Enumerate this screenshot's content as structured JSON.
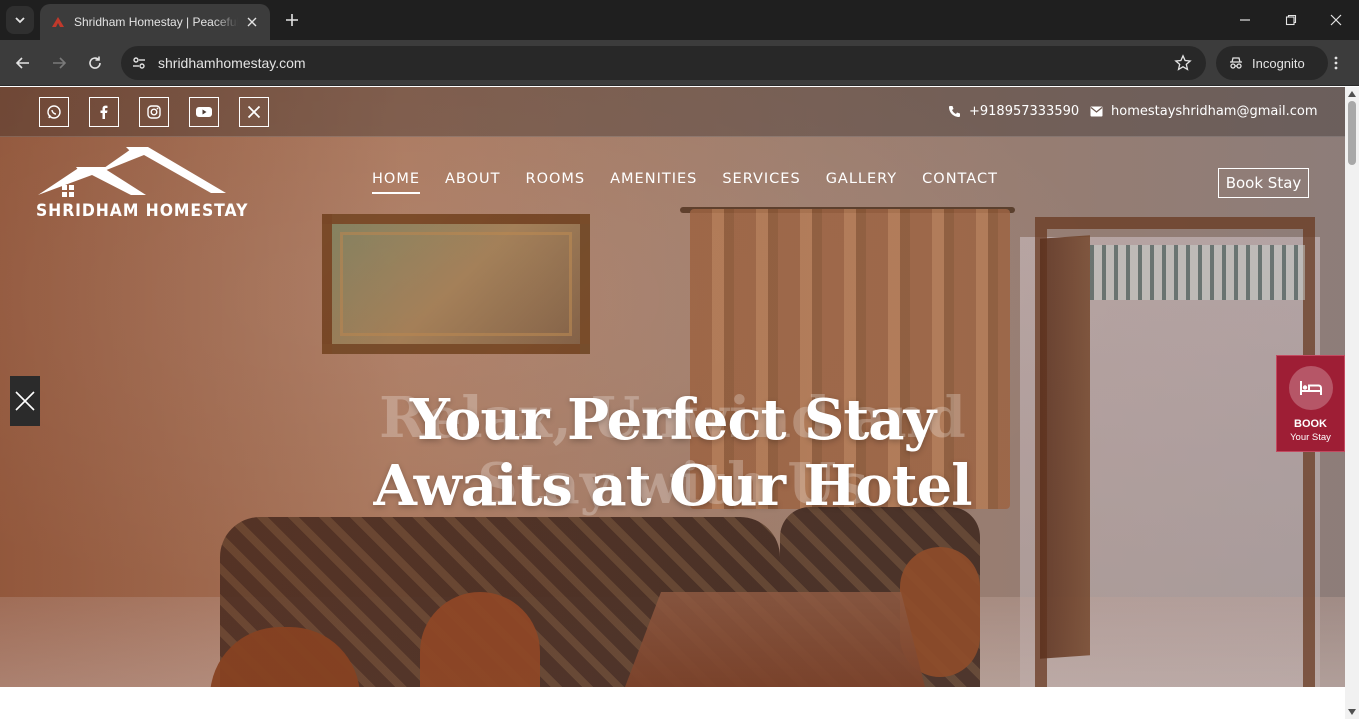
{
  "browser": {
    "tab_title": "Shridham Homestay | Peaceful & Comfortable Stay",
    "url": "shridhamhomestay.com",
    "incognito_label": "Incognito"
  },
  "topbar": {
    "social": [
      "whatsapp-icon",
      "facebook-icon",
      "instagram-icon",
      "youtube-icon",
      "x-icon"
    ],
    "phone": "+918957333590",
    "email": "homestayshridham@gmail.com"
  },
  "header": {
    "logo_text": "SHRIDHAM HOMESTAY",
    "nav": [
      "HOME",
      "ABOUT",
      "ROOMS",
      "AMENITIES",
      "SERVICES",
      "GALLERY",
      "CONTACT"
    ],
    "active_nav": "HOME",
    "book_button": "Book Stay"
  },
  "hero": {
    "headline_line1": "Your Perfect Stay",
    "headline_line2": "Awaits at Our Hotel",
    "ghost_line1": "Relax, Unwind and",
    "ghost_line2": "Stay with Us"
  },
  "floating_book": {
    "line1": "BOOK",
    "line2": "Your Stay"
  },
  "colors": {
    "accent": "#9e1e35",
    "chrome_dark": "#1f1f1f",
    "chrome_toolbar": "#3c3c3c"
  }
}
